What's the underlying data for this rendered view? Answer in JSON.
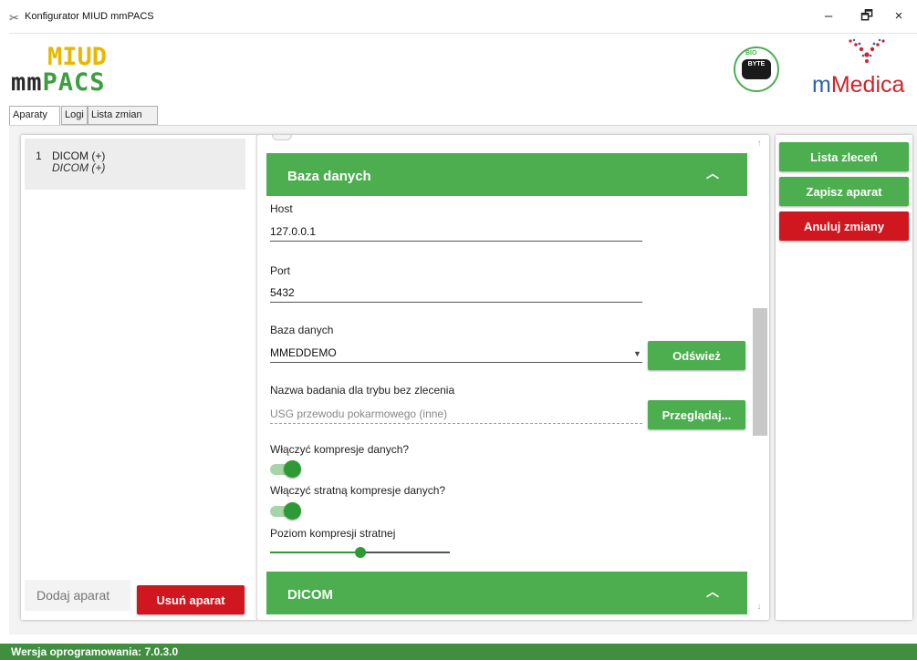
{
  "window": {
    "title": "Konfigurator MIUD mmPACS",
    "minimize": "–",
    "maximize": "🗗",
    "close": "×"
  },
  "header": {
    "logo_miud": "MIUD",
    "logo_mmpacs_prefix": "mm",
    "logo_mmpacs_suffix": "PACS",
    "logo_biobyte_top": "BIO",
    "logo_biobyte_bottom": "BYTE",
    "logo_mmedica_prefix": "m",
    "logo_mmedica_suffix": "Medica"
  },
  "tabs": [
    "Aparaty",
    "Logi",
    "Lista zmian"
  ],
  "devices": [
    {
      "num": "1",
      "name": "DICOM (+)",
      "subtitle": "DICOM (+)"
    }
  ],
  "left_panel": {
    "add_placeholder": "Dodaj aparat",
    "remove_label": "Usuń aparat"
  },
  "sections": {
    "database": {
      "title": "Baza danych",
      "host_label": "Host",
      "host_value": "127.0.0.1",
      "port_label": "Port",
      "port_value": "5432",
      "db_label": "Baza danych",
      "db_value": "MMEDDEMO",
      "refresh_label": "Odśwież",
      "exam_label": "Nazwa badania dla trybu bez zlecenia",
      "exam_value": "USG przewodu pokarmowego (inne)",
      "browse_label": "Przeglądaj...",
      "compression_label": "Włączyć kompresje danych?",
      "compression_on": true,
      "lossy_label": "Włączyć stratną kompresje danych?",
      "lossy_on": true,
      "lossy_level_label": "Poziom kompresji stratnej",
      "lossy_level_fraction": 0.5
    },
    "dicom": {
      "title": "DICOM"
    }
  },
  "right_panel": {
    "orders_label": "Lista zleceń",
    "save_label": "Zapisz aparat",
    "cancel_label": "Anuluj zmiany"
  },
  "statusbar": {
    "version_text": "Wersja oprogramowania: 7.0.3.0"
  },
  "icons": {
    "app": "tools-icon",
    "chevron": "chevron-up-icon",
    "scroll_up": "arrow-up-icon",
    "scroll_down": "arrow-down-icon"
  },
  "colors": {
    "accent_green": "#4cae4f",
    "danger_red": "#d0161e",
    "status_green": "#3f8f3f"
  }
}
